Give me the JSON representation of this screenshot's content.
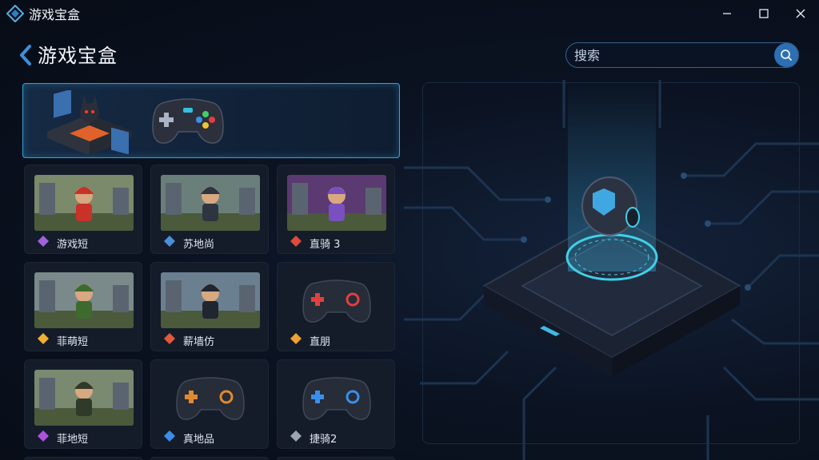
{
  "titlebar": {
    "app_title": "游戏宝盒",
    "minimize_glyph": "—",
    "maximize_glyph": "☐",
    "close_glyph": "✕"
  },
  "header": {
    "page_title": "游戏宝盒",
    "search_placeholder": "搜索"
  },
  "featured": {
    "items": [
      "fortress-art",
      "gamepad-art"
    ]
  },
  "games": [
    {
      "label": "游戏短",
      "icon": "flower-icon",
      "thumb": "red-cap-hero"
    },
    {
      "label": "苏地尚",
      "icon": "shield-icon",
      "thumb": "hooded-ninja"
    },
    {
      "label": "直骑 3",
      "icon": "heart-icon",
      "thumb": "elf-warrior"
    },
    {
      "label": "菲萌短",
      "icon": "cube-icon",
      "thumb": "goblin-warrior"
    },
    {
      "label": "薪墙仿",
      "icon": "robot-icon",
      "thumb": "hooded-figure"
    },
    {
      "label": "直朋",
      "icon": "cross-swords-icon",
      "thumb": "gamepad-red"
    },
    {
      "label": "菲地短",
      "icon": "stack-icon",
      "thumb": "small-hero"
    },
    {
      "label": "真地品",
      "icon": "flame-icon",
      "thumb": "gamepad-orange"
    },
    {
      "label": "捷骑2",
      "icon": "plus-icon",
      "thumb": "gamepad-blue"
    }
  ],
  "colors": {
    "accent": "#2fa6d6",
    "search_button": "#2c6fb3",
    "tile_bg": "#141c2a",
    "background": "#0b1322"
  }
}
